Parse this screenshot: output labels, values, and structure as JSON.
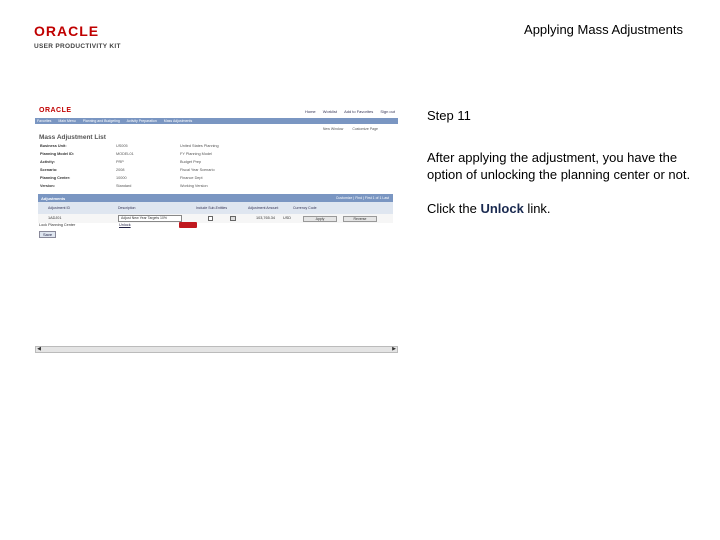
{
  "header": {
    "logo_brand": "ORACLE",
    "logo_sub": "USER PRODUCTIVITY KIT",
    "title": "Applying Mass Adjustments"
  },
  "screenshot": {
    "brand": "ORACLE",
    "top_links": [
      "Home",
      "Worklist",
      "Add to Favorites",
      "Sign out"
    ],
    "nav_items": [
      "Favorites",
      "Main Menu",
      "Planning and Budgeting",
      "Activity Preparation",
      "Mass Adjustments"
    ],
    "sub_links": [
      "New Window",
      "Customize Page"
    ],
    "page_title": "Mass Adjustment List",
    "fields": [
      {
        "label": "Business Unit:",
        "value": "US005",
        "desc": "United States Planning"
      },
      {
        "label": "Planning Model ID:",
        "value": "MODEL01",
        "desc": "FY Planning Model"
      },
      {
        "label": "Activity:",
        "value": "PRP",
        "desc": "Budget Prep"
      },
      {
        "label": "Scenario:",
        "value": "2008",
        "desc": "Fiscal Year Scenario"
      },
      {
        "label": "Planning Center:",
        "value": "10000",
        "desc": "Finance Dept"
      },
      {
        "label": "Version:",
        "value": "Standard",
        "desc": "Working Version"
      }
    ],
    "grid": {
      "title": "Adjustments",
      "nav": "Customize | Find | First 1 of 1 Last",
      "columns": [
        "Adjustment ID",
        "Description",
        "Include Sub-Entities",
        "Adjustment Amount",
        "Currency Code"
      ],
      "row": {
        "id": "1ADJ01",
        "description": "Adjust New Year Targets 10%",
        "amount": "103,765.34",
        "currency": "USD",
        "apply_label": "Apply",
        "reverse_label": "Reverse"
      }
    },
    "unlock_row": {
      "label": "Lock Planning Center",
      "link": "Unlock"
    },
    "save_label": "Save"
  },
  "instructions": {
    "step": "Step 11",
    "paragraph": "After applying the adjustment, you have the option of unlocking the planning center or not.",
    "click_prefix": "Click the ",
    "click_target": "Unlock",
    "click_suffix": " link."
  }
}
